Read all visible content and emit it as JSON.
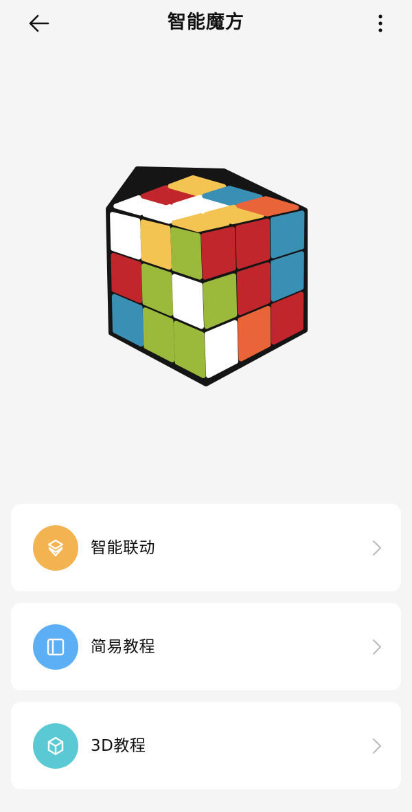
{
  "header": {
    "title": "智能魔方",
    "back_icon": "arrow-left-icon",
    "more_icon": "more-vertical-icon"
  },
  "device": {
    "image": "smart-rubiks-cube",
    "colors": {
      "white": "#ffffff",
      "red": "#c0262c",
      "green": "#9bba3b",
      "blue": "#3a8fb4",
      "orange": "#ea643a",
      "yellow": "#f4c452",
      "body": "#151515"
    }
  },
  "menu": [
    {
      "label": "智能联动",
      "icon": "layers-icon",
      "color": "#f2b350"
    },
    {
      "label": "简易教程",
      "icon": "book-panel-icon",
      "color": "#5caef5"
    },
    {
      "label": "3D教程",
      "icon": "cube-3d-icon",
      "color": "#5ac9d3"
    }
  ]
}
